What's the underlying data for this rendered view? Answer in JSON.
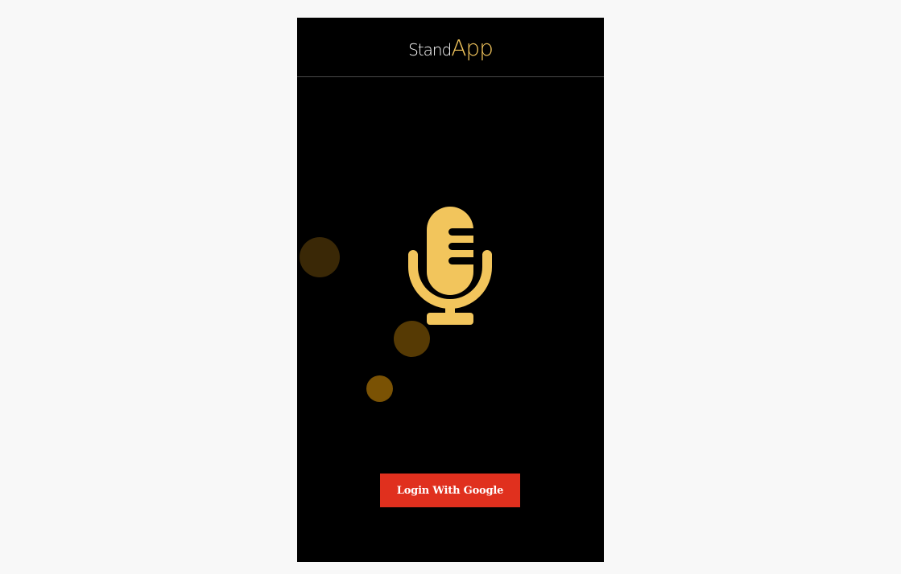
{
  "header": {
    "logo_part1": "Stand",
    "logo_part2": "App"
  },
  "hero": {
    "icon": "microphone-icon"
  },
  "auth": {
    "login_label": "Login With Google"
  },
  "colors": {
    "background": "#000000",
    "accent": "#f2c55c",
    "button": "#e0301e",
    "page": "#f8f8f8"
  }
}
